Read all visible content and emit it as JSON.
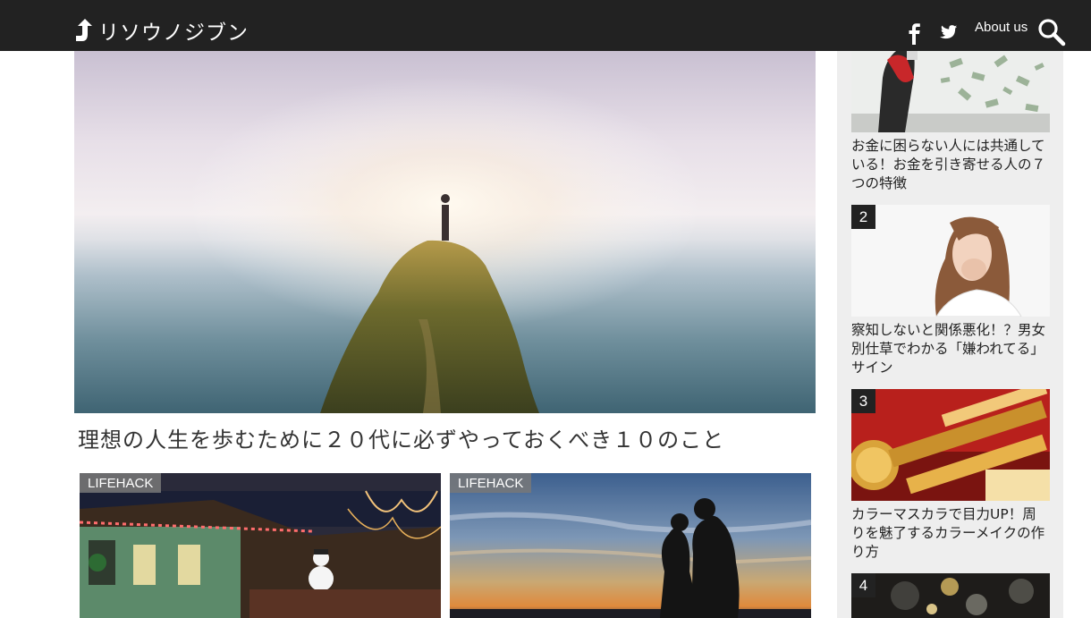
{
  "header": {
    "logo_text": "リソウノジブン",
    "about_label": "About us"
  },
  "hero": {
    "title": "理想の人生を歩むために２０代に必ずやっておくべき１０のこと"
  },
  "cards": [
    {
      "tag": "LIFEHACK"
    },
    {
      "tag": "LIFEHACK"
    }
  ],
  "ranking": [
    {
      "num": "",
      "title": "お金に困らない人には共通している！お金を引き寄せる人の７つの特徴"
    },
    {
      "num": "2",
      "title": "察知しないと関係悪化！？男女別仕草でわかる「嫌われてる」サイン"
    },
    {
      "num": "3",
      "title": "カラーマスカラで目力UP！周りを魅了するカラーメイクの作り方"
    },
    {
      "num": "4",
      "title": ""
    }
  ],
  "icons": {
    "logo": "up-arrow-icon",
    "facebook": "facebook-icon",
    "twitter": "twitter-icon",
    "search": "search-icon"
  }
}
